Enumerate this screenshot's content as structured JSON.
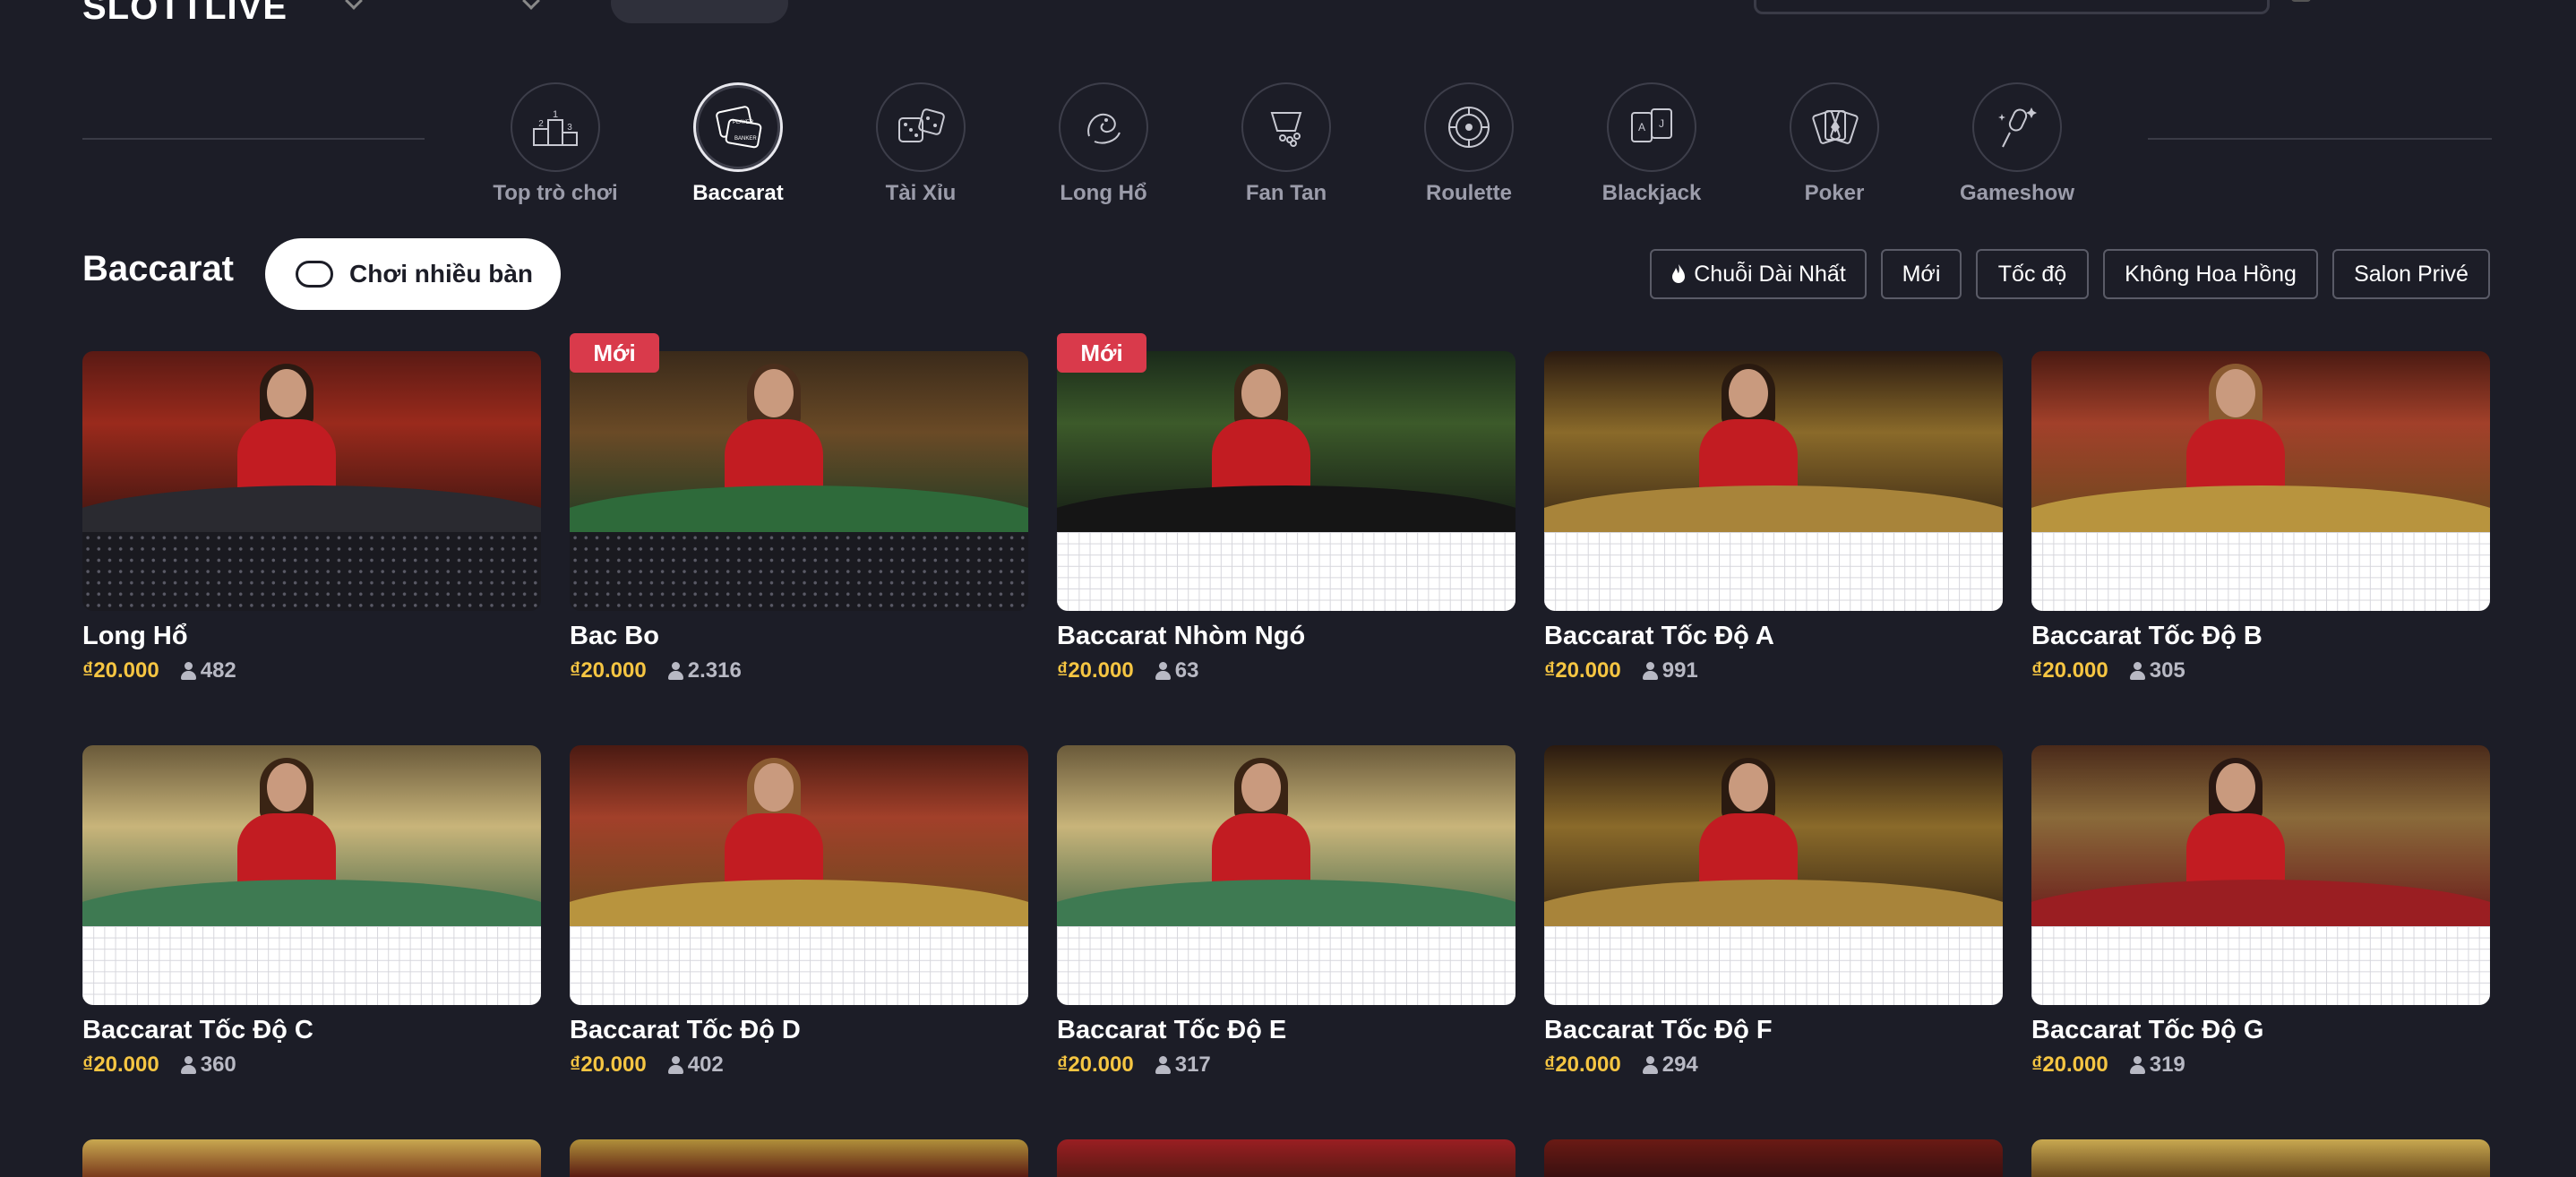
{
  "header": {
    "logo_text": "SLOTTLIVE"
  },
  "categories": [
    {
      "label": "Top trò chơi",
      "icon": "podium-icon",
      "active": false
    },
    {
      "label": "Baccarat",
      "icon": "baccarat-cards-icon",
      "active": true
    },
    {
      "label": "Tài Xỉu",
      "icon": "dice-icon",
      "active": false
    },
    {
      "label": "Long Hổ",
      "icon": "dragon-icon",
      "active": false
    },
    {
      "label": "Fan Tan",
      "icon": "fan-tan-icon",
      "active": false
    },
    {
      "label": "Roulette",
      "icon": "roulette-icon",
      "active": false
    },
    {
      "label": "Blackjack",
      "icon": "blackjack-cards-icon",
      "active": false
    },
    {
      "label": "Poker",
      "icon": "poker-cards-icon",
      "active": false
    },
    {
      "label": "Gameshow",
      "icon": "microphone-icon",
      "active": false
    }
  ],
  "section": {
    "title": "Baccarat",
    "multi_table_label": "Chơi nhiều bàn"
  },
  "filters": [
    "Chuỗi Dài Nhất",
    "Mới",
    "Tốc độ",
    "Không Hoa Hồng",
    "Salon Privé"
  ],
  "games": [
    {
      "name": "Long Hổ",
      "price": "₫20.000",
      "players": "482",
      "badge": "",
      "theme": "red"
    },
    {
      "name": "Bac Bo",
      "price": "₫20.000",
      "players": "2.316",
      "badge": "Mới",
      "theme": "green"
    },
    {
      "name": "Baccarat Nhòm Ngó",
      "price": "₫20.000",
      "players": "63",
      "badge": "Mới",
      "theme": "peek"
    },
    {
      "name": "Baccarat Tốc Độ A",
      "price": "₫20.000",
      "players": "991",
      "badge": "",
      "theme": "gold"
    },
    {
      "name": "Baccarat Tốc Độ B",
      "price": "₫20.000",
      "players": "305",
      "badge": "",
      "theme": "redgold"
    },
    {
      "name": "Baccarat Tốc Độ C",
      "price": "₫20.000",
      "players": "360",
      "badge": "",
      "theme": "cream"
    },
    {
      "name": "Baccarat Tốc Độ D",
      "price": "₫20.000",
      "players": "402",
      "badge": "",
      "theme": "redgold"
    },
    {
      "name": "Baccarat Tốc Độ E",
      "price": "₫20.000",
      "players": "317",
      "badge": "",
      "theme": "cream"
    },
    {
      "name": "Baccarat Tốc Độ F",
      "price": "₫20.000",
      "players": "294",
      "badge": "",
      "theme": "gold"
    },
    {
      "name": "Baccarat Tốc Độ G",
      "price": "₫20.000",
      "players": "319",
      "badge": "",
      "theme": "redtable"
    }
  ],
  "colors": {
    "background": "#1c1d27",
    "price": "#f5c542",
    "badge": "#d93a4b",
    "banker": "#d93a4b",
    "player": "#2f6fd8"
  }
}
